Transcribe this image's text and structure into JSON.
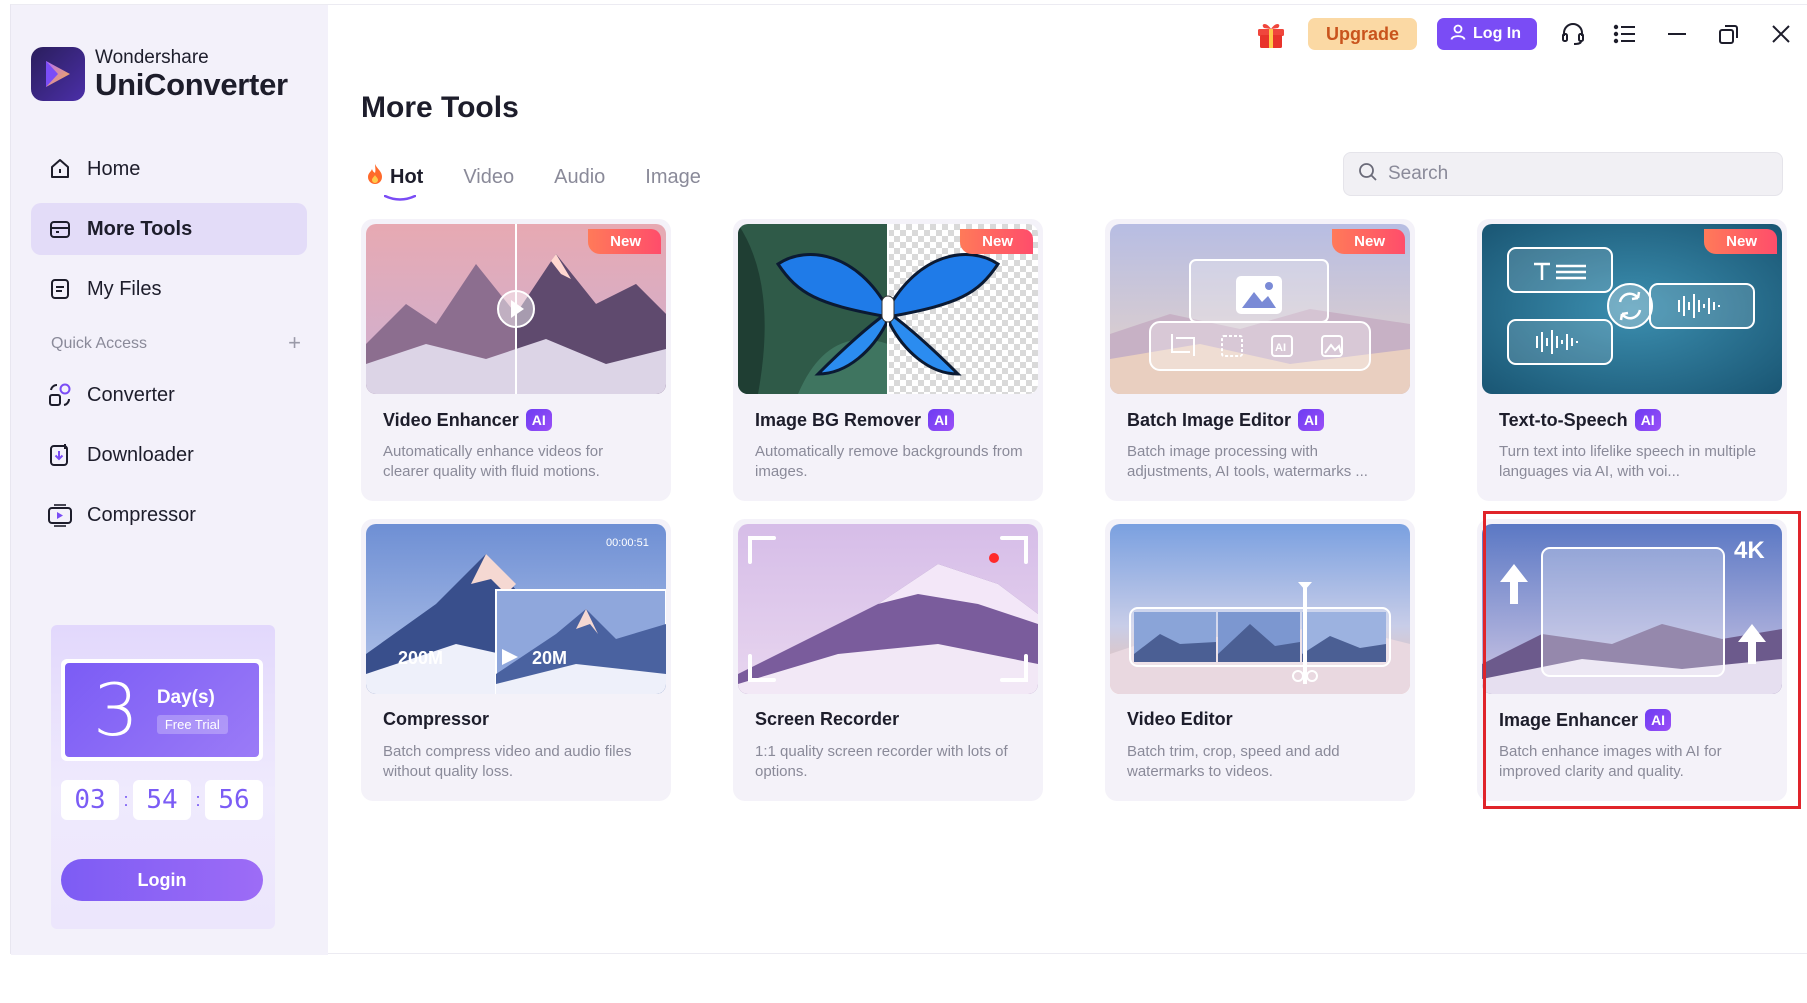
{
  "brand": {
    "company": "Wondershare",
    "product": "UniConverter"
  },
  "sidebar": {
    "nav": [
      {
        "label": "Home",
        "icon": "home-icon"
      },
      {
        "label": "More Tools",
        "icon": "toolbox-icon",
        "active": true
      },
      {
        "label": "My Files",
        "icon": "file-icon"
      }
    ],
    "quick_access_label": "Quick Access",
    "quick_access_add": "+",
    "quick_items": [
      {
        "label": "Converter",
        "icon": "converter-icon"
      },
      {
        "label": "Downloader",
        "icon": "downloader-icon"
      },
      {
        "label": "Compressor",
        "icon": "compressor-icon"
      }
    ]
  },
  "trial": {
    "number": "3",
    "days_label": "Day(s)",
    "free_trial_label": "Free Trial",
    "timer": [
      "03",
      "54",
      "56"
    ],
    "login_label": "Login"
  },
  "topbar": {
    "upgrade_label": "Upgrade",
    "login_label": "Log In"
  },
  "main": {
    "title": "More Tools",
    "tabs": [
      {
        "label": "Hot",
        "active": true
      },
      {
        "label": "Video"
      },
      {
        "label": "Audio"
      },
      {
        "label": "Image"
      }
    ],
    "search_placeholder": "Search",
    "cards": [
      {
        "title": "Video Enhancer",
        "ai": "AI",
        "new": "New",
        "desc": "Automatically enhance videos for clearer quality with fluid motions."
      },
      {
        "title": "Image BG Remover",
        "ai": "AI",
        "new": "New",
        "desc": "Automatically remove backgrounds from images."
      },
      {
        "title": "Batch Image Editor",
        "ai": "AI",
        "new": "New",
        "desc": "Batch image processing with adjustments, AI tools, watermarks ..."
      },
      {
        "title": "Text-to-Speech",
        "ai": "AI",
        "new": "New",
        "desc": "Turn text into lifelike speech in multiple languages via AI, with voi..."
      },
      {
        "title": "Compressor",
        "desc": "Batch compress video and audio files without quality loss.",
        "thumb": {
          "from": "200M",
          "to": "20M",
          "time": "00:00:51"
        }
      },
      {
        "title": "Screen Recorder",
        "desc": "1:1 quality screen recorder with lots of options."
      },
      {
        "title": "Video Editor",
        "desc": "Batch trim, crop, speed and add watermarks to videos."
      },
      {
        "title": "Image Enhancer",
        "ai": "AI",
        "desc": "Batch enhance images with AI for improved clarity and quality.",
        "thumb": {
          "res": "4K"
        }
      }
    ]
  },
  "colors": {
    "accent": "#7a4cf5",
    "sidebar_bg": "#f3f1fa",
    "active_nav": "#e3dcf8",
    "upgrade_bg": "#fbd9a4",
    "new_badge": "#ff5a62",
    "highlight_border": "#e0242a"
  }
}
